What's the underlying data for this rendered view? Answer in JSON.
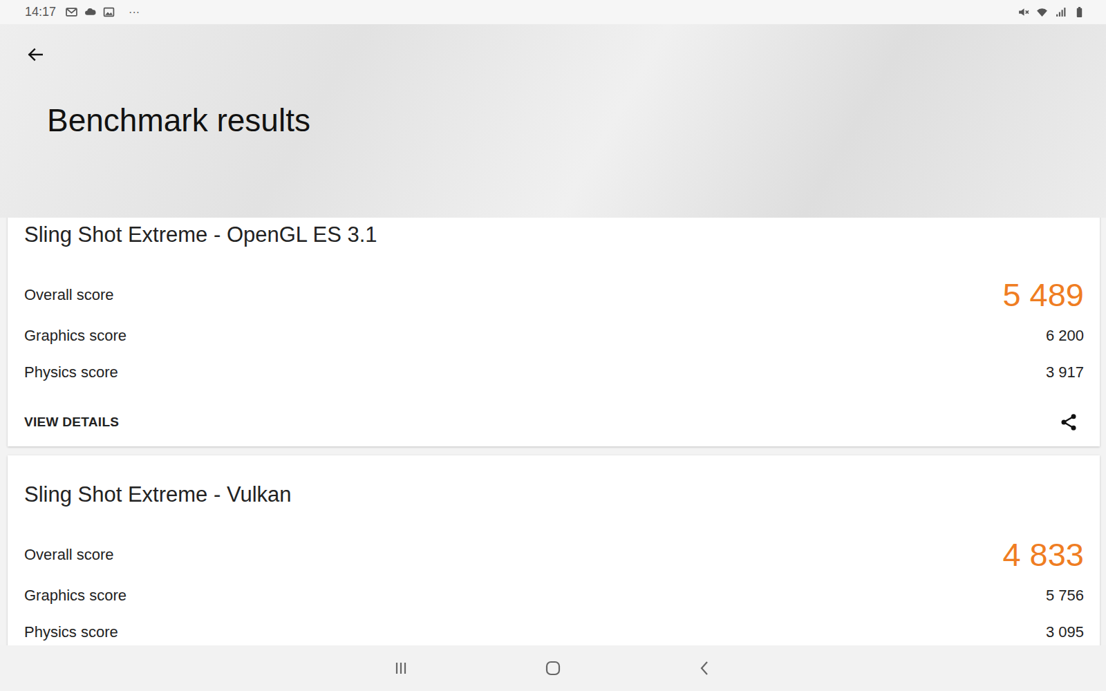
{
  "status_bar": {
    "time": "14:17",
    "more": "···"
  },
  "header": {
    "title": "Benchmark results"
  },
  "results": [
    {
      "title": "Sling Shot Extreme - OpenGL ES 3.1",
      "overall_label": "Overall score",
      "overall": "5 489",
      "scores": [
        {
          "label": "Graphics score",
          "value": "6 200"
        },
        {
          "label": "Physics score",
          "value": "3 917"
        }
      ],
      "action": "VIEW DETAILS"
    },
    {
      "title": "Sling Shot Extreme - Vulkan",
      "overall_label": "Overall score",
      "overall": "4 833",
      "scores": [
        {
          "label": "Graphics score",
          "value": "5 756"
        },
        {
          "label": "Physics score",
          "value": "3 095"
        }
      ]
    }
  ]
}
